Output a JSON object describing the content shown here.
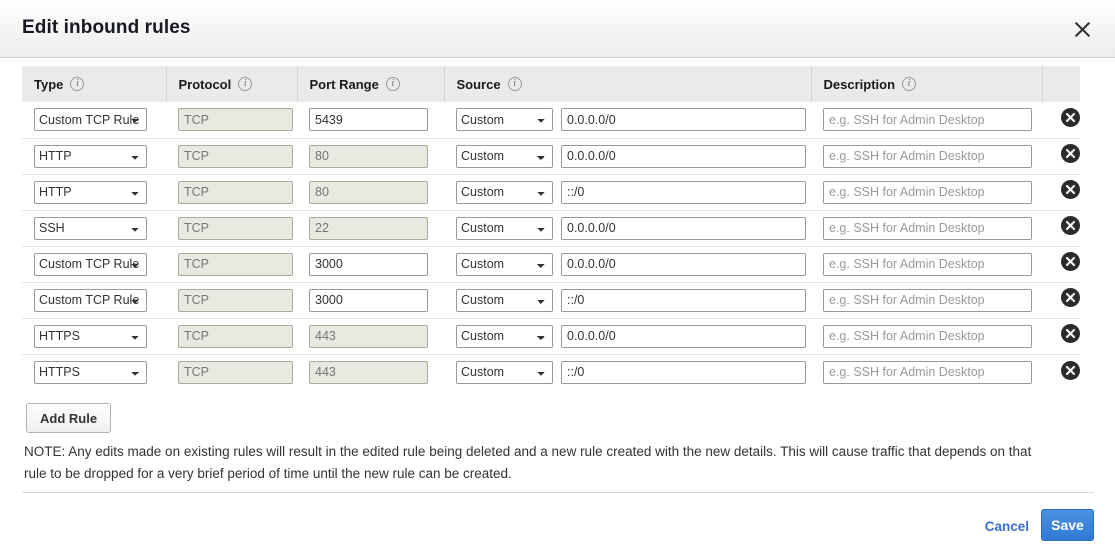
{
  "dialog": {
    "title": "Edit inbound rules",
    "close_label": "×"
  },
  "table": {
    "headers": {
      "type": "Type",
      "protocol": "Protocol",
      "port_range": "Port Range",
      "source": "Source",
      "description": "Description"
    },
    "info_icon_label": "i",
    "description_placeholder": "e.g. SSH for Admin Desktop",
    "delete_icon_name": "delete-circle-x-icon",
    "rows": [
      {
        "type": "Custom TCP Rule",
        "protocol": "TCP",
        "protocol_disabled": true,
        "port": "5439",
        "port_disabled": false,
        "source_kind": "Custom",
        "source_value": "0.0.0.0/0",
        "description": ""
      },
      {
        "type": "HTTP",
        "protocol": "TCP",
        "protocol_disabled": true,
        "port": "80",
        "port_disabled": true,
        "source_kind": "Custom",
        "source_value": "0.0.0.0/0",
        "description": ""
      },
      {
        "type": "HTTP",
        "protocol": "TCP",
        "protocol_disabled": true,
        "port": "80",
        "port_disabled": true,
        "source_kind": "Custom",
        "source_value": "::/0",
        "description": ""
      },
      {
        "type": "SSH",
        "protocol": "TCP",
        "protocol_disabled": true,
        "port": "22",
        "port_disabled": true,
        "source_kind": "Custom",
        "source_value": "0.0.0.0/0",
        "description": ""
      },
      {
        "type": "Custom TCP Rule",
        "protocol": "TCP",
        "protocol_disabled": true,
        "port": "3000",
        "port_disabled": false,
        "source_kind": "Custom",
        "source_value": "0.0.0.0/0",
        "description": ""
      },
      {
        "type": "Custom TCP Rule",
        "protocol": "TCP",
        "protocol_disabled": true,
        "port": "3000",
        "port_disabled": false,
        "source_kind": "Custom",
        "source_value": "::/0",
        "description": ""
      },
      {
        "type": "HTTPS",
        "protocol": "TCP",
        "protocol_disabled": true,
        "port": "443",
        "port_disabled": true,
        "source_kind": "Custom",
        "source_value": "0.0.0.0/0",
        "description": ""
      },
      {
        "type": "HTTPS",
        "protocol": "TCP",
        "protocol_disabled": true,
        "port": "443",
        "port_disabled": true,
        "source_kind": "Custom",
        "source_value": "::/0",
        "description": ""
      }
    ]
  },
  "actions": {
    "add_rule": "Add Rule",
    "cancel": "Cancel",
    "save": "Save"
  },
  "note": "NOTE: Any edits made on existing rules will result in the edited rule being deleted and a new rule created with the new details. This will cause traffic that depends on that rule to be dropped for a very brief period of time until the new rule can be created.",
  "colors": {
    "accent_blue": "#3b7fd4",
    "link_blue": "#3b6fd4",
    "header_bg": "#eaeaea",
    "disabled_field_bg": "#e9e9e1",
    "title_text": "#16191f"
  }
}
